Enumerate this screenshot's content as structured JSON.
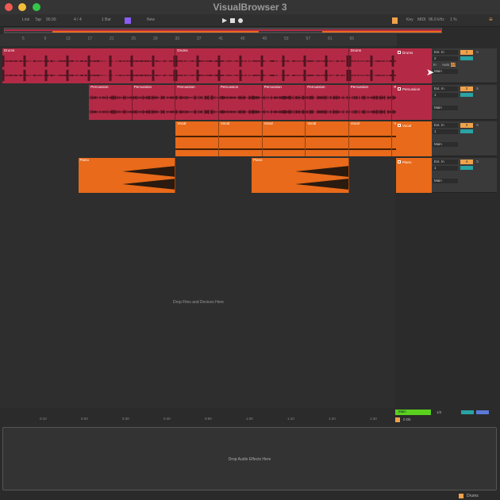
{
  "window": {
    "title": "VisualBrowser 3"
  },
  "toolbar": {
    "link": "Link",
    "tap": "Tap",
    "tempo": "90.00",
    "meter": "4 / 4",
    "quantize": "1 Bar",
    "key_btn": "New",
    "key": "Key",
    "midi": "MIDI",
    "sample_rate": "96.0 kHz",
    "cpu": "1 %"
  },
  "ruler": {
    "ticks": [
      "5",
      "9",
      "13",
      "17",
      "21",
      "25",
      "29",
      "33",
      "37",
      "41",
      "45",
      "49",
      "53",
      "57",
      "61",
      "65"
    ]
  },
  "tracks": [
    {
      "name": "Drums",
      "color": "#b42a46",
      "input": "Ext. In",
      "channel": "2",
      "monitor": [
        "In",
        "Auto",
        "Off"
      ],
      "out": "Main",
      "number": "1",
      "clips": [
        {
          "name": "Drums",
          "start": 0,
          "len": 8
        },
        {
          "name": "Drums",
          "start": 8,
          "len": 8
        },
        {
          "name": "Drums",
          "start": 16,
          "len": 2.2
        }
      ]
    },
    {
      "name": "Percussion",
      "color": "#b42a46",
      "input": "Ext. In",
      "channel": "1",
      "out": "Main",
      "number": "2",
      "clips": [
        {
          "name": "Percussion",
          "start": 4,
          "len": 2
        },
        {
          "name": "Percussion",
          "start": 6,
          "len": 2
        },
        {
          "name": "Percussion",
          "start": 8,
          "len": 2
        },
        {
          "name": "Percussion",
          "start": 10,
          "len": 2
        },
        {
          "name": "Percussion",
          "start": 12,
          "len": 2
        },
        {
          "name": "Percussion",
          "start": 14,
          "len": 2
        },
        {
          "name": "Percussion",
          "start": 16,
          "len": 2
        },
        {
          "name": "R",
          "start": 18,
          "len": 0.2
        }
      ]
    },
    {
      "name": "Vocal",
      "color": "#e86a1a",
      "input": "Ext. In",
      "channel": "1",
      "out": "Main",
      "number": "3",
      "clips": [
        {
          "name": "Vocal",
          "start": 8,
          "len": 2
        },
        {
          "name": "Vocal",
          "start": 10,
          "len": 2
        },
        {
          "name": "Vocal",
          "start": 12,
          "len": 2
        },
        {
          "name": "Vocal",
          "start": 14,
          "len": 2
        },
        {
          "name": "Vocal",
          "start": 16,
          "len": 2
        },
        {
          "name": "V",
          "start": 18,
          "len": 0.2
        }
      ]
    },
    {
      "name": "Piano",
      "color": "#e86a1a",
      "input": "Ext. In",
      "channel": "1",
      "out": "Main",
      "number": "4",
      "clips": [
        {
          "name": "Piano",
          "start": 3.5,
          "len": 4.5
        },
        {
          "name": "Piano",
          "start": 11.5,
          "len": 4.5
        }
      ]
    }
  ],
  "arrangement": {
    "drop_hint": "Drop Files and Devices Here"
  },
  "time_ruler": [
    "0:10",
    "0:20",
    "0:30",
    "0:40",
    "0:50",
    "1:00",
    "1:10",
    "1:20",
    "1:30"
  ],
  "main": {
    "name": "Main",
    "routing": "1/2",
    "count": "1/2",
    "sends": "0 Db"
  },
  "device": {
    "drop_hint": "Drop Audio Effects Here"
  },
  "status": {
    "selected_track": "Drums"
  }
}
